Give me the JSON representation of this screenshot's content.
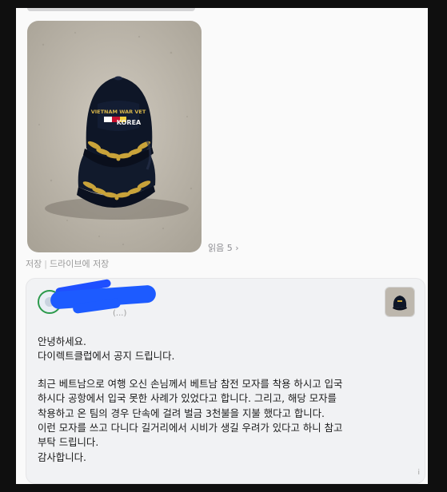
{
  "chat": {
    "read_count": "읽음 5",
    "read_chevron": "›",
    "save_label": "저장",
    "save_separator": "|",
    "save_drive_label": "드라이브에 저장"
  },
  "photo": {
    "cap_text_line1": "VIETNAM WAR VET",
    "cap_text_line2": "KOREA",
    "colors": {
      "cap": "#0e1627",
      "leaf": "#c9a33a",
      "floor": "#c2bcb1"
    }
  },
  "email": {
    "sender_sub": "(...)",
    "corner_mark": "i",
    "paragraphs": [
      [
        "안녕하세요.",
        "다이렉트클럽에서 공지 드립니다."
      ],
      [
        "최근 베트남으로 여행 오신 손님께서 베트남 참전 모자를 착용 하시고 입국",
        "하시다 공항에서 입국 못한 사례가 있었다고 합니다. 그리고, 해당 모자를",
        "착용하고 온 팀의 경우 단속에 걸려 벌금 3천불을 지불 했다고 합니다.",
        "이런 모자를 쓰고 다니다 길거리에서 시비가 생길 우려가 있다고 하니 참고",
        "부탁 드립니다.",
        "감사합니다."
      ]
    ]
  }
}
